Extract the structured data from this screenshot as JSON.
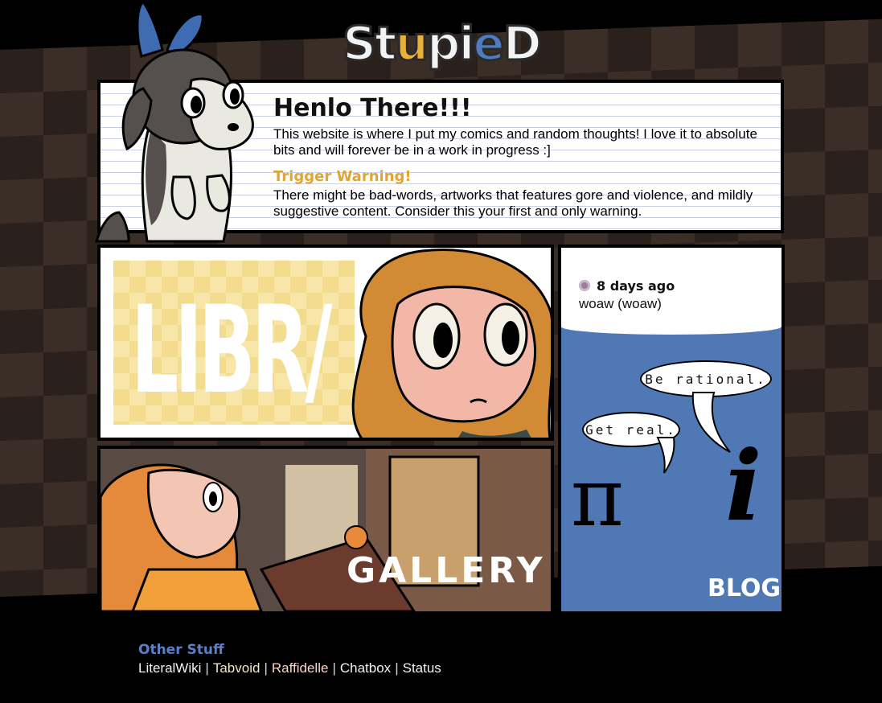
{
  "site": {
    "logo_text": [
      "S",
      "t",
      "u",
      "p",
      "i",
      "e",
      "D"
    ],
    "logo_label": "Stupied"
  },
  "intro": {
    "title": "Henlo There!!!",
    "description": "This website is where I put my comics and random thoughts! I love it to absolute bits and will forever be in a work in progress :]",
    "warning_title": "Trigger Warning!",
    "warning_text": "There might be bad-words, artworks that features gore and violence, and mildly suggestive content. Consider this your first and only warning."
  },
  "sections": {
    "library_label": "LIBR/",
    "gallery_label": "GALLERY",
    "blog_label": "BLOG"
  },
  "blog": {
    "post_time": "8 days ago",
    "post_text": "woaw (woaw)",
    "bubble_1": "Be rational.",
    "bubble_2": "Get real.",
    "symbol_pi": "π",
    "symbol_i": "i"
  },
  "footer": {
    "title": "Other Stuff",
    "links": [
      "LiteralWiki",
      "Tabvoid",
      "Raffidelle",
      "Chatbox",
      "Status"
    ],
    "separator": "|"
  },
  "colors": {
    "accent_blue": "#4f78b5",
    "warning_orange": "#e2a532",
    "footer_title": "#5b80c7"
  }
}
